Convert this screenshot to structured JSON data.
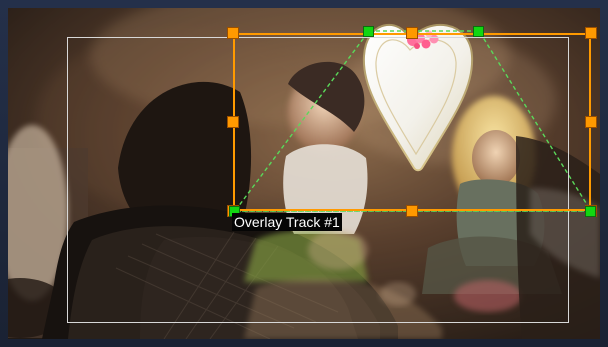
{
  "preview": {
    "overlay_label": "Overlay Track #1"
  },
  "icons": {
    "overlay_object": "heart-icon"
  },
  "colors": {
    "selection": "#ff9900",
    "perspective_handle": "#12d712",
    "safe_area": "#d8d8d8",
    "label_bg": "#050505",
    "label_text": "#ffffff"
  }
}
